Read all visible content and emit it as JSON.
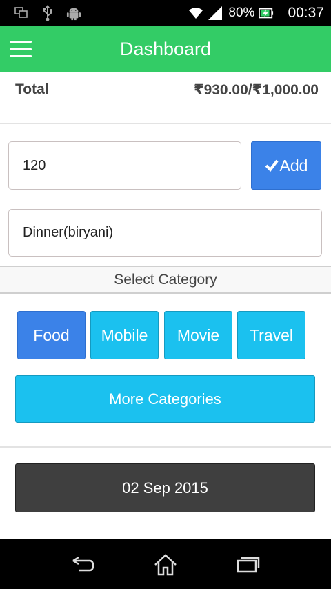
{
  "status_bar": {
    "battery": "80%",
    "time": "00:37",
    "icons": [
      "screenshot-icon",
      "usb-icon",
      "android-icon",
      "wifi-icon",
      "signal-icon",
      "battery-charging-icon"
    ]
  },
  "app_bar": {
    "title": "Dashboard",
    "color": "#33cc66"
  },
  "summary": {
    "total_label": "Total",
    "total_value": "₹930.00/₹1,000.00"
  },
  "form": {
    "amount_value": "120",
    "add_label": "Add",
    "description_value": "Dinner(biryani)"
  },
  "categories": {
    "header": "Select Category",
    "items": [
      {
        "label": "Food",
        "selected": true
      },
      {
        "label": "Mobile",
        "selected": false
      },
      {
        "label": "Movie",
        "selected": false
      },
      {
        "label": "Travel",
        "selected": false
      }
    ],
    "more_label": "More Categories",
    "selected_color": "#3b82e8",
    "default_color": "#1bc1ef"
  },
  "date": {
    "value": "02 Sep 2015"
  }
}
